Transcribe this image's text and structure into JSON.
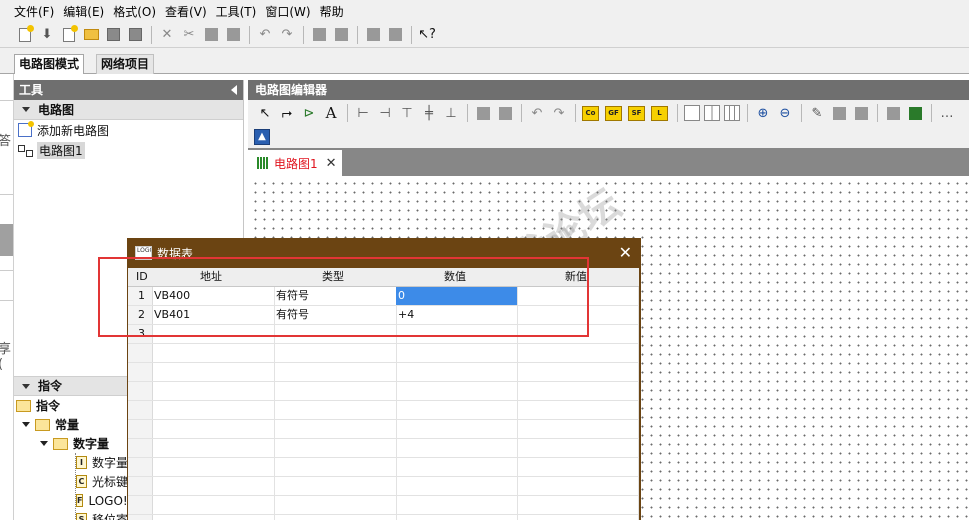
{
  "menu": [
    "文件(F)",
    "编辑(E)",
    "格式(O)",
    "查看(V)",
    "工具(T)",
    "窗口(W)",
    "帮助"
  ],
  "mode_tabs": {
    "active": "电路图模式",
    "inactive": "网络项目"
  },
  "tools_panel": {
    "title": "工具",
    "section": "电路图",
    "items": [
      "添加新电路图",
      "电路图1"
    ]
  },
  "left_fragments": {
    "top": "答",
    "bottom": "享("
  },
  "instructions_panel": {
    "title": "指令",
    "tree": {
      "root": "指令",
      "constants": "常量",
      "digital": "数字量",
      "leaves": [
        {
          "badge": "I",
          "label": "数字量"
        },
        {
          "badge": "C",
          "label": "光标键"
        },
        {
          "badge": "F",
          "label": "LOGO! T"
        },
        {
          "badge": "S",
          "label": "移位寄"
        }
      ]
    }
  },
  "editor": {
    "title": "电路图编辑器",
    "toolbar_badges": [
      "Co",
      "GF",
      "SF",
      "L"
    ],
    "doc_tab": "电路图1"
  },
  "data_table": {
    "title": "数据表",
    "logo": "LOGO",
    "columns": {
      "id": "ID",
      "address": "地址",
      "type": "类型",
      "value": "数值",
      "new_value": "新值"
    },
    "rows": [
      {
        "id": "1",
        "address": "VB400",
        "type": "有符号",
        "value": "0",
        "new_value": ""
      },
      {
        "id": "2",
        "address": "VB401",
        "type": "有符号",
        "value": "+4",
        "new_value": ""
      },
      {
        "id": "3",
        "address": "",
        "type": "",
        "value": "",
        "new_value": ""
      }
    ],
    "selected_value_color": "#3d8be8"
  },
  "watermark": {
    "line1": "西门子工业",
    "line2": "技术论坛",
    "url": "support.industry.siemens.com"
  },
  "highlight_color": "#e23535"
}
